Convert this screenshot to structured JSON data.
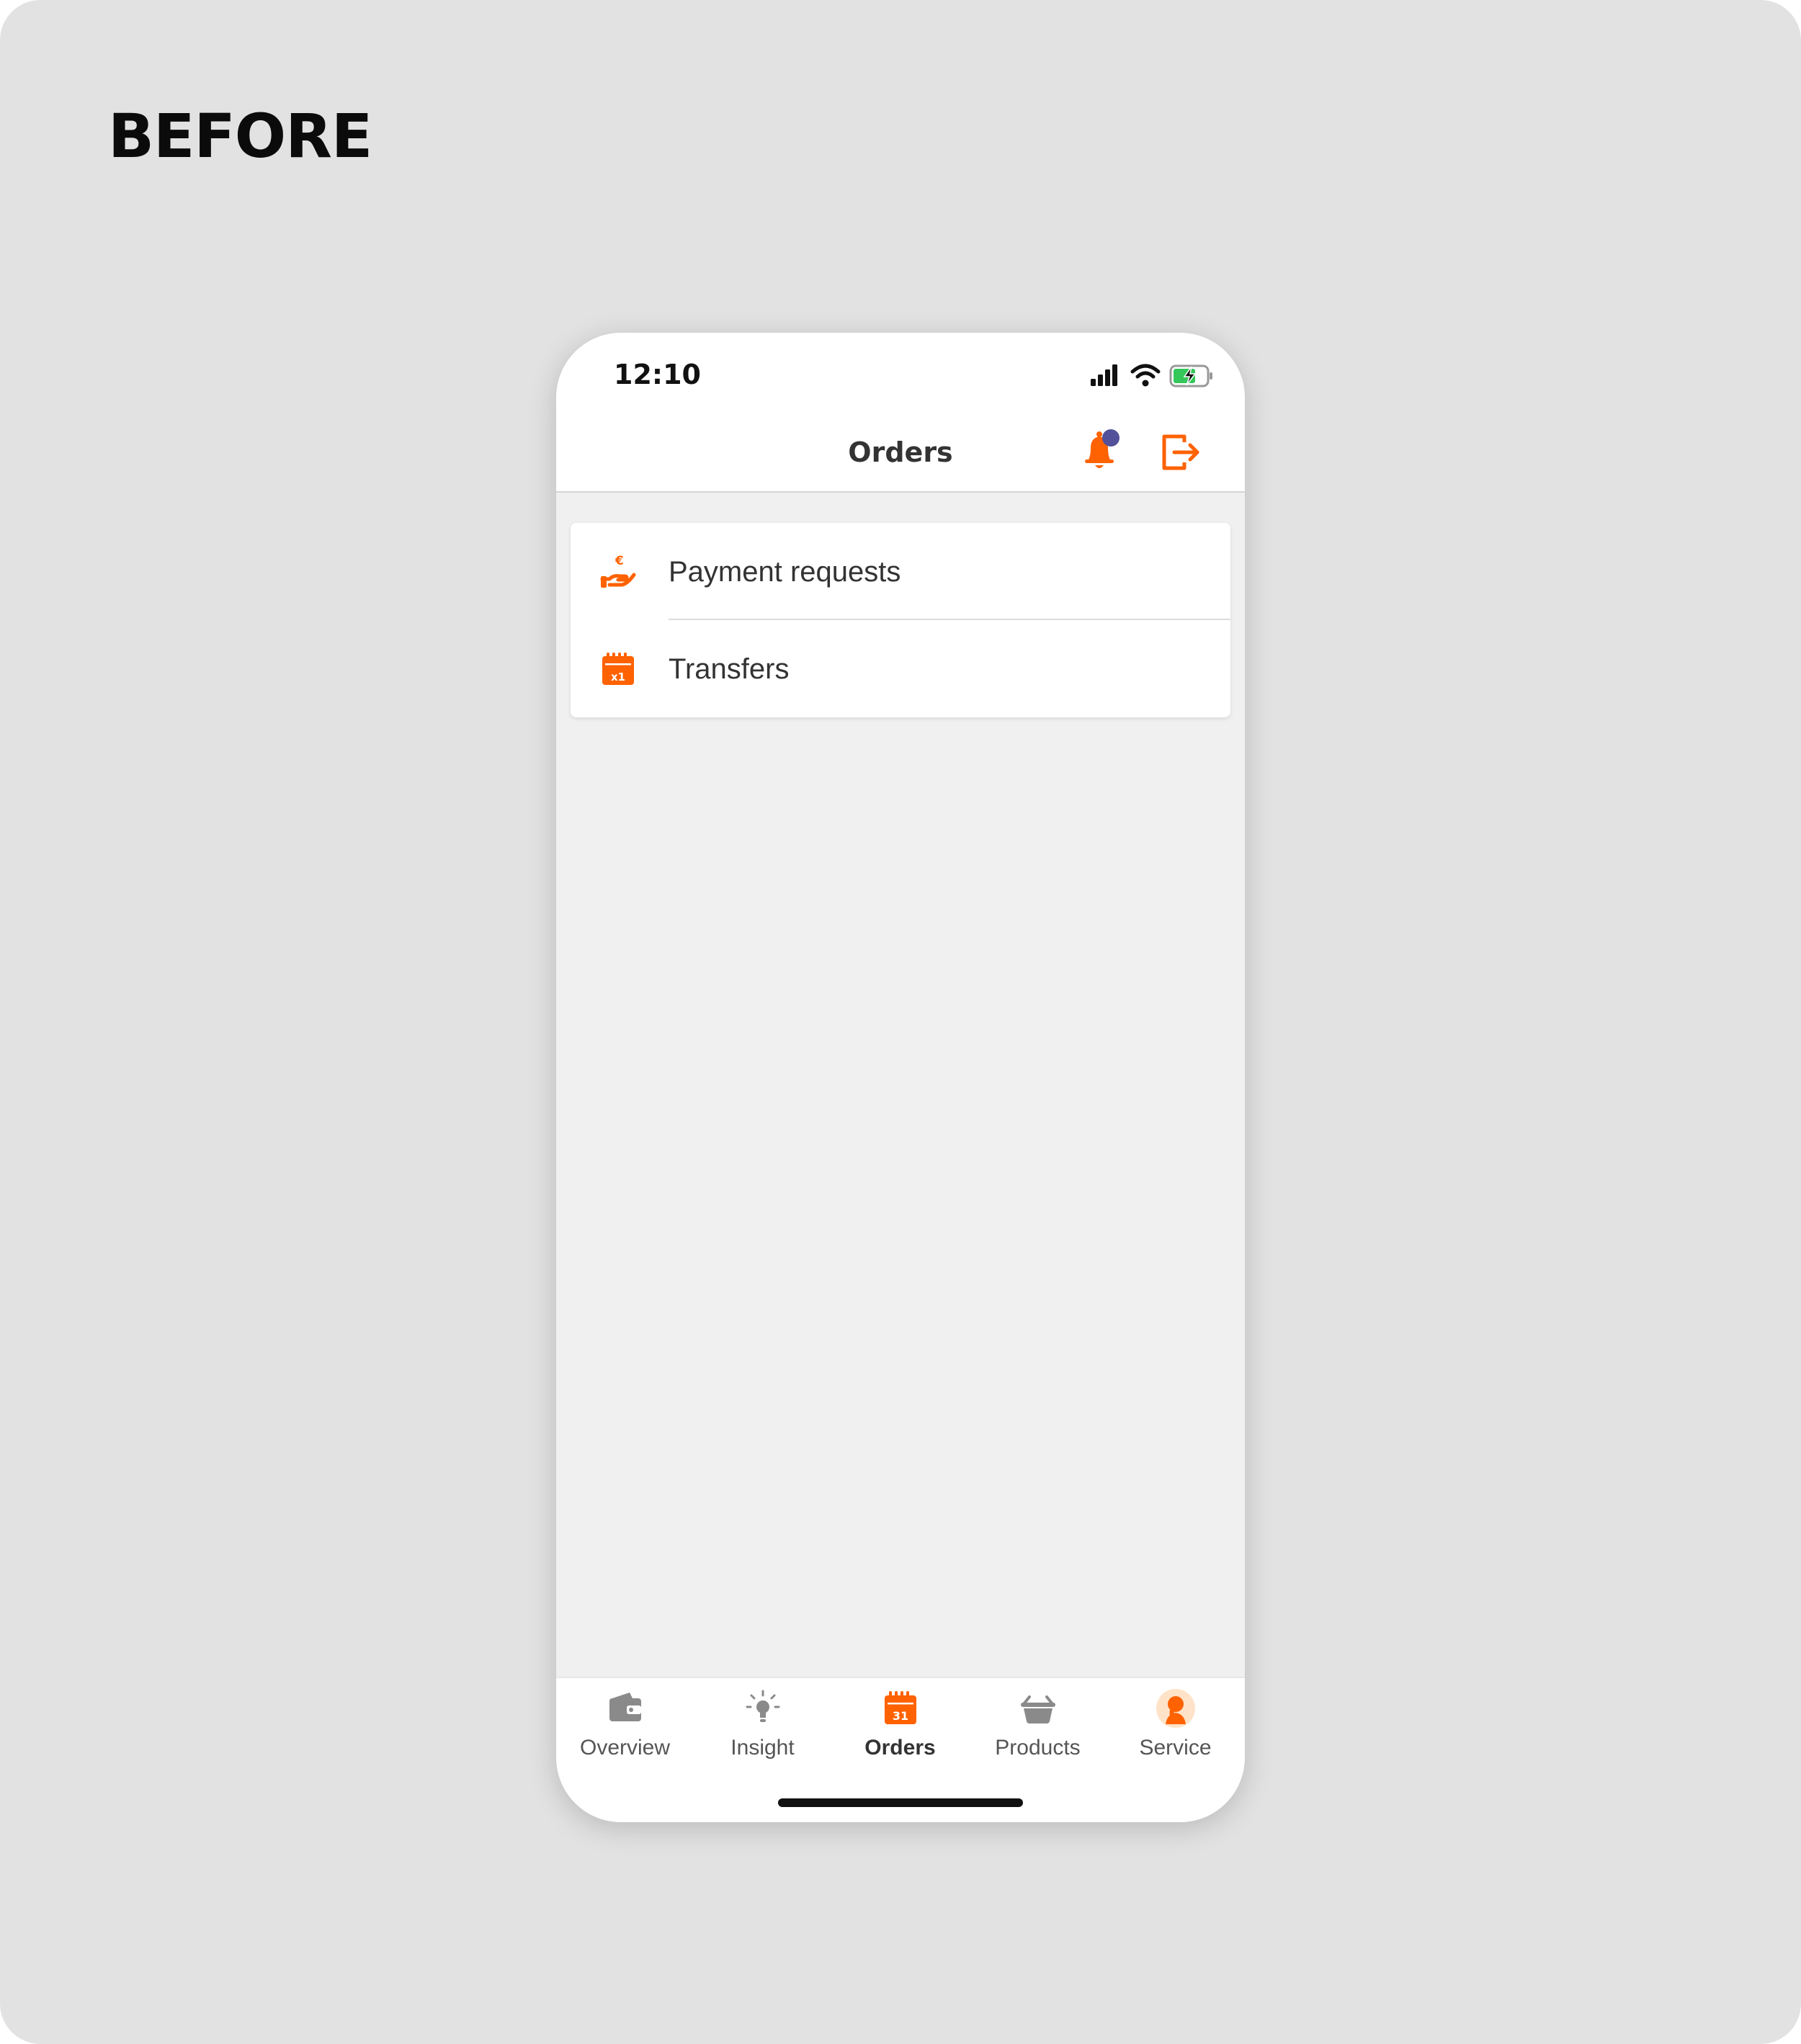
{
  "page_heading": "BEFORE",
  "status_bar": {
    "time": "12:10"
  },
  "nav": {
    "title": "Orders",
    "has_notification_dot": true
  },
  "menu": {
    "items": [
      {
        "label": "Payment requests",
        "icon": "hand-euro-icon"
      },
      {
        "label": "Transfers",
        "icon": "calendar-x1-icon"
      }
    ]
  },
  "tabbar": {
    "tabs": [
      {
        "label": "Overview",
        "icon": "wallet-icon",
        "active": false
      },
      {
        "label": "Insight",
        "icon": "lightbulb-icon",
        "active": false
      },
      {
        "label": "Orders",
        "icon": "calendar-icon",
        "active": true
      },
      {
        "label": "Products",
        "icon": "basket-icon",
        "active": false
      },
      {
        "label": "Service",
        "icon": "person-avatar-icon",
        "active": false
      }
    ]
  },
  "colors": {
    "accent": "#ff6200",
    "notification_dot": "#525199",
    "inactive_icon": "#8a8a8a",
    "background": "#e2e2e2",
    "screen_background": "#f0f0f0",
    "battery": "#34c759"
  },
  "calendar_icon_text": {
    "transfers": "x1",
    "orders_tab": "31"
  }
}
